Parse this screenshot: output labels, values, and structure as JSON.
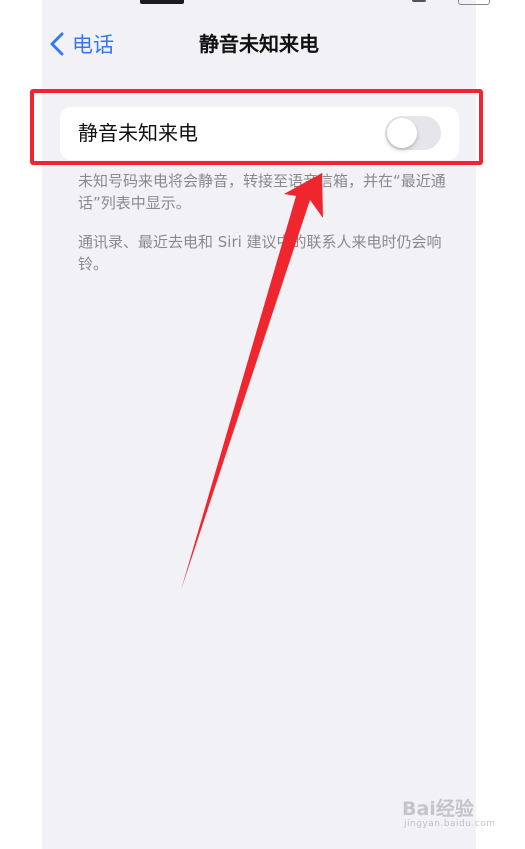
{
  "nav": {
    "back_label": "电话",
    "title": "静音未知来电"
  },
  "settings": {
    "row_label": "静音未知来电",
    "toggle_state": "off"
  },
  "footnotes": [
    "未知号码来电将会静音，转接至语音信箱，并在“最近通话”列表中显示。",
    "通讯录、最近去电和 Siri 建议中的联系人来电时仍会响铃。"
  ],
  "watermark": {
    "logo": "Bai经验",
    "sub": "jingyan.baidu.com"
  },
  "colors": {
    "accent": "#3478f6",
    "annotation": "#f0262e",
    "background": "#f2f1f6"
  }
}
